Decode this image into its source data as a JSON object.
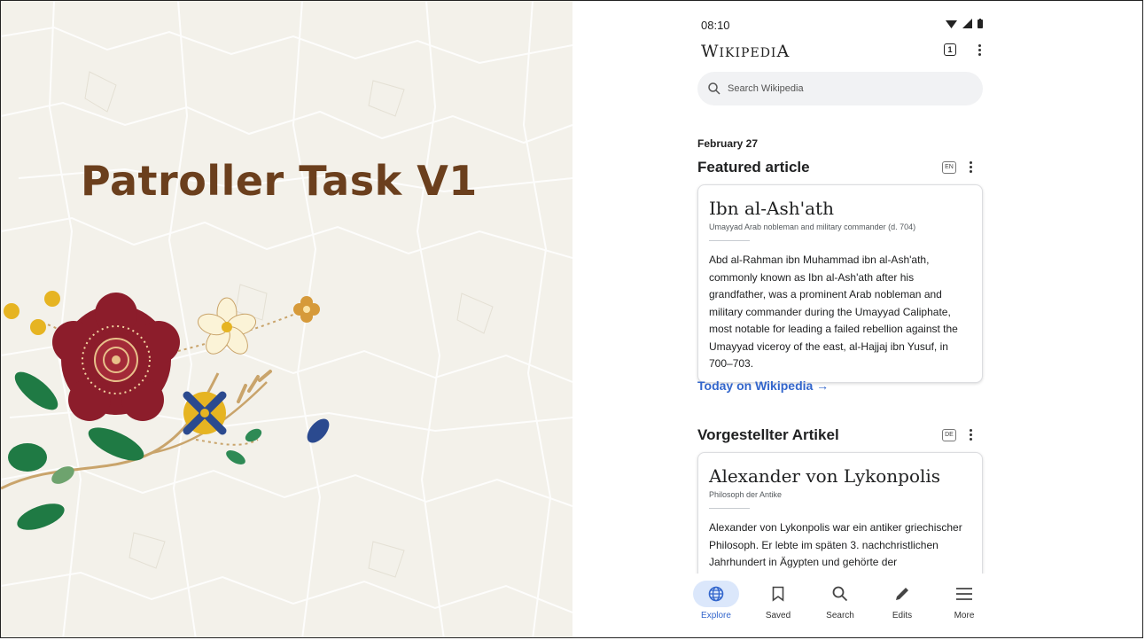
{
  "slide": {
    "title": "Patroller Task V1"
  },
  "phone": {
    "status_time": "08:10",
    "wordmark": {
      "first": "W",
      "rest": "IKIPEDI",
      "last": "A"
    },
    "tabs_count": "1",
    "search_placeholder": "Search Wikipedia",
    "date": "February 27",
    "featured": {
      "header": "Featured article",
      "lang": "EN",
      "title": "Ibn al-Ash'ath",
      "subtitle": "Umayyad Arab nobleman and military commander (d. 704)",
      "body": "Abd al-Rahman ibn Muhammad ibn al-Ash'ath, commonly known as Ibn al-Ash'ath after his grandfather, was a prominent Arab nobleman and military commander during the Umayyad Caliphate, most notable for leading a failed rebellion against the Umayyad viceroy of the east, al-Hajjaj ibn Yusuf, in 700–703."
    },
    "today_link": "Today on Wikipedia →",
    "vorgestellter": {
      "header": "Vorgestellter Artikel",
      "lang": "DE",
      "title": "Alexander von Lykonpolis",
      "subtitle": "Philosoph der Antike",
      "body": "Alexander von Lykonpolis war ein antiker griechischer Philosoph. Er lebte im späten 3. nachchristlichen Jahrhundert in Ägypten und gehörte der"
    },
    "nav": [
      {
        "label": "Explore",
        "icon": "globe-icon",
        "active": true
      },
      {
        "label": "Saved",
        "icon": "bookmark-icon"
      },
      {
        "label": "Search",
        "icon": "search-icon"
      },
      {
        "label": "Edits",
        "icon": "pencil-icon"
      },
      {
        "label": "More",
        "icon": "menu-icon"
      }
    ]
  },
  "colors": {
    "title": "#6b3f1d",
    "link": "#3366cc",
    "active_nav": "#dbe7fb",
    "flower_red": "#8c1d2b",
    "leaf_green": "#1f7a44",
    "gold": "#e6b422"
  }
}
